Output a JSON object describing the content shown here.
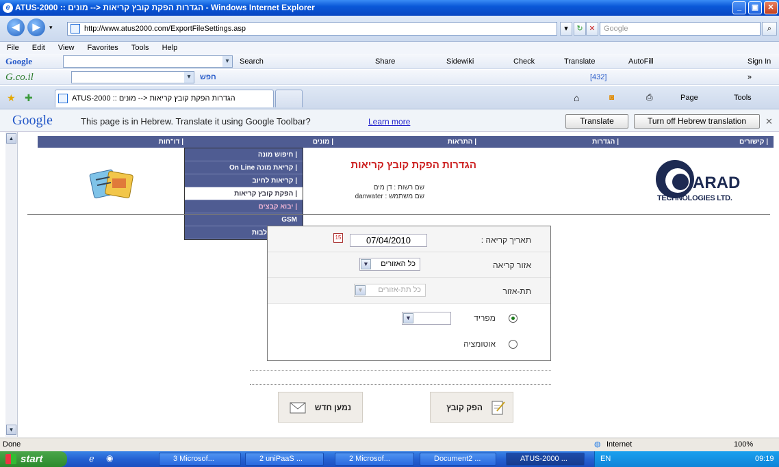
{
  "window": {
    "title": "ATUS-2000 :: הגדרות הפקת קובץ קריאות <-- מונים - Windows Internet Explorer"
  },
  "address": {
    "url": "http://www.atus2000.com/ExportFileSettings.asp",
    "search_placeholder": "Google"
  },
  "menubar": [
    "File",
    "Edit",
    "View",
    "Favorites",
    "Tools",
    "Help"
  ],
  "google_toolbar": {
    "label": "Google",
    "items": [
      "Search",
      "Share",
      "Sidewiki",
      "Check",
      "Translate",
      "AutoFill",
      "Sign In"
    ]
  },
  "gcoil_toolbar": {
    "label": "G.co.il",
    "search_text": "חפש",
    "count": "[432]"
  },
  "tab": {
    "label": "ATUS-2000 :: הגדרות הפקת קובץ קריאות <-- מונים"
  },
  "command_bar": {
    "page": "Page",
    "tools": "Tools"
  },
  "translate_bar": {
    "logo": "Google",
    "message": "This page is in Hebrew.  Translate it using Google Toolbar?",
    "learn_more": "Learn more",
    "translate": "Translate",
    "turn_off": "Turn off Hebrew translation"
  },
  "site_nav": {
    "items": [
      "| קישורים",
      "| הגדרות",
      "| התראות",
      "| מונים",
      "| דו\"חות"
    ]
  },
  "dropdown": {
    "items": [
      "| חיפוש מונה",
      "| קריאת מונה On Line",
      "| קריאות לחיוב",
      "| הפקת קובץ קריאות",
      "| יבוא קבצים",
      "GSM",
      "| תיקון הצלבות"
    ]
  },
  "page": {
    "title": "הגדרות הפקת קובץ קריאות",
    "authority_label": "שם רשות : דן מים",
    "user_label": "שם משתמש : danwater",
    "logo_main": "ARAD",
    "logo_sub": "TECHNOLOGIES LTD."
  },
  "form": {
    "date_label": "תאריך קריאה :",
    "date_value": "07/04/2010",
    "area_label": "אזור קריאה",
    "area_value": "כל האזורים",
    "subarea_label": "תת-אזור",
    "subarea_value": "כל תת-אזורים",
    "separator_label": "מפריד",
    "automation_label": "אוטומציה"
  },
  "buttons": {
    "export": "הפק קובץ",
    "new_load": "נמען חדש"
  },
  "status": {
    "left": "Done",
    "zone": "Internet",
    "zoom": "100%"
  },
  "taskbar": {
    "start": "start",
    "items": [
      "3 Microsof...",
      "2 uniPaaS ...",
      "2 Microsof...",
      "Document2 ...",
      "ATUS-2000 ..."
    ],
    "lang": "EN",
    "time": "09:19"
  }
}
